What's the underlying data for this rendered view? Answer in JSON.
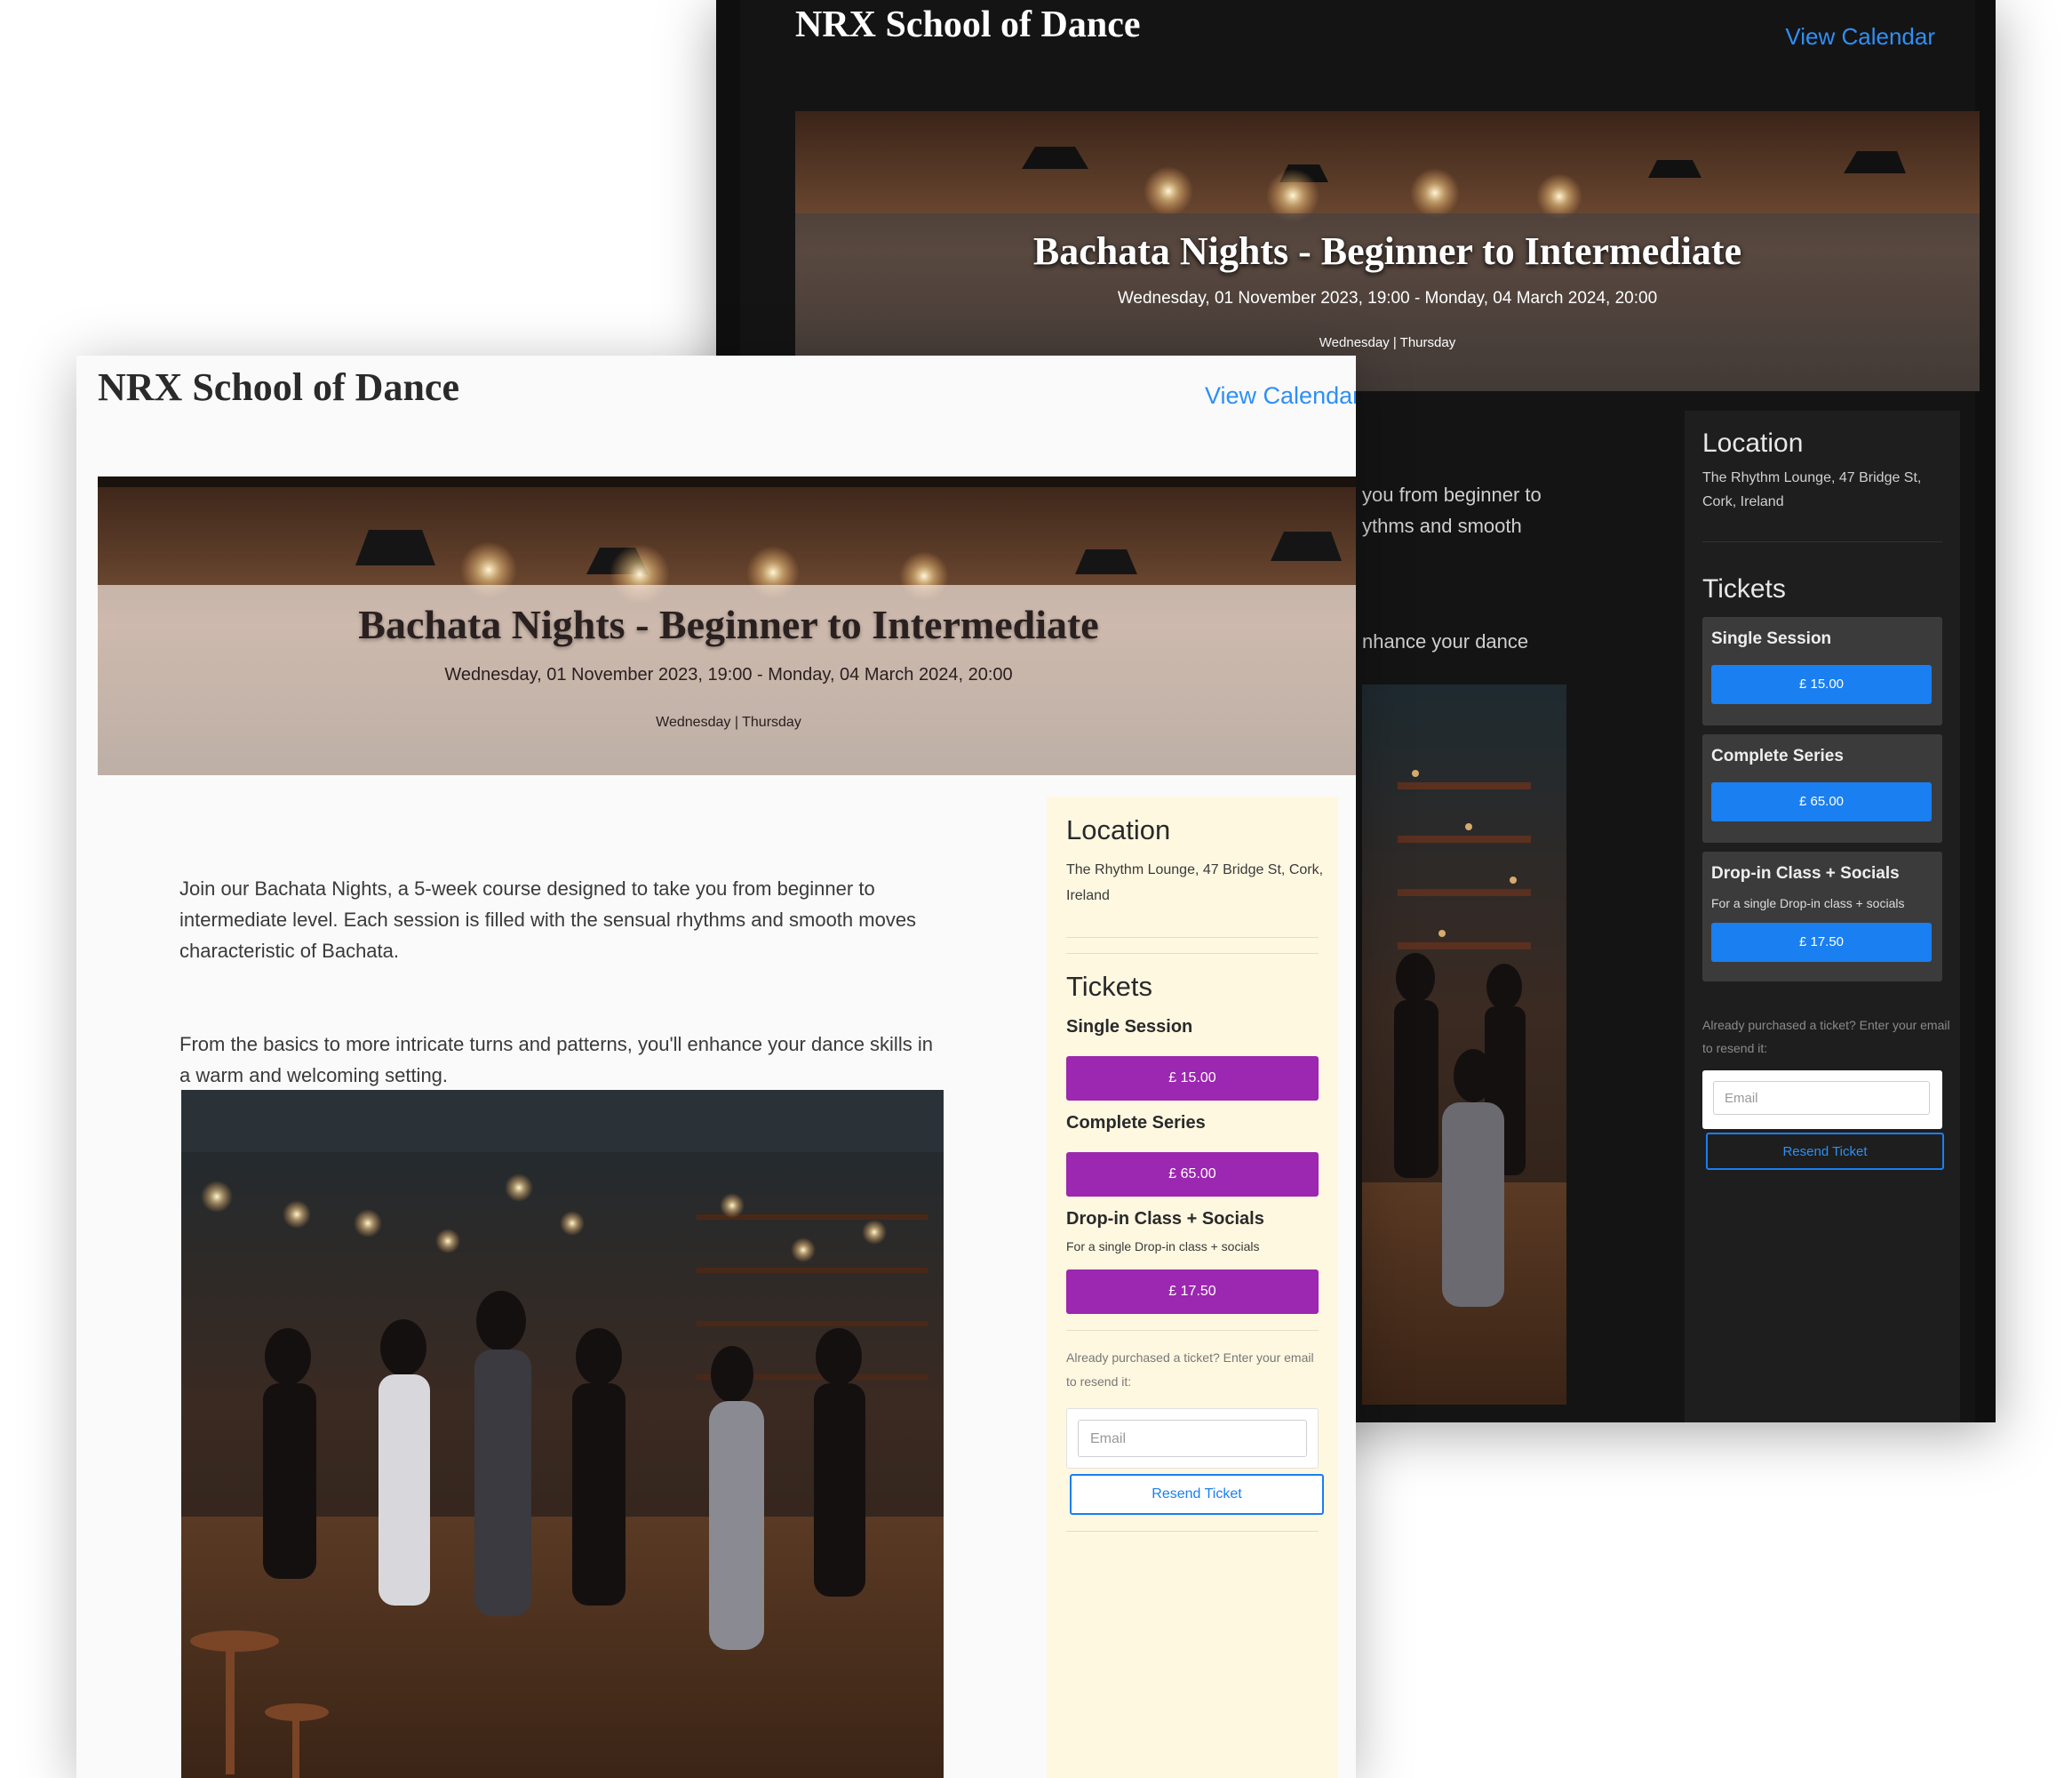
{
  "back_screen": {
    "brand": "NRX School of Dance",
    "view_calendar": "View Calendar",
    "event": {
      "title": "Bachata Nights - Beginner to Intermediate",
      "dates": "Wednesday, 01 November 2023, 19:00 - Monday, 04 March 2024, 20:00",
      "days": "Wednesday | Thursday"
    },
    "description_fragments": [
      "you from beginner to",
      "ythms and smooth",
      "nhance your dance"
    ],
    "location": {
      "heading": "Location",
      "address": "The Rhythm Lounge, 47 Bridge St, Cork, Ireland"
    },
    "tickets": {
      "heading": "Tickets",
      "items": [
        {
          "name": "Single Session",
          "note": "",
          "price": "£ 15.00"
        },
        {
          "name": "Complete Series",
          "note": "",
          "price": "£ 65.00"
        },
        {
          "name": "Drop-in Class + Socials",
          "note": "For a single Drop-in class + socials",
          "price": "£ 17.50"
        }
      ]
    },
    "resend": {
      "note": "Already purchased a ticket? Enter your email to resend it:",
      "email_placeholder": "Email",
      "button": "Resend Ticket"
    }
  },
  "front_screen": {
    "brand": "NRX School of Dance",
    "view_calendar": "View Calendar",
    "event": {
      "title": "Bachata Nights - Beginner to Intermediate",
      "dates": "Wednesday, 01 November 2023, 19:00 - Monday, 04 March 2024, 20:00",
      "days": "Wednesday | Thursday"
    },
    "description": [
      "Join our Bachata Nights, a 5-week course designed to take you from beginner to intermediate level. Each session is filled with the sensual rhythms and smooth moves characteristic of Bachata.",
      "From the basics to more intricate turns and patterns, you'll enhance your dance skills in a warm and welcoming setting."
    ],
    "location": {
      "heading": "Location",
      "address": "The Rhythm Lounge, 47 Bridge St, Cork, Ireland"
    },
    "tickets": {
      "heading": "Tickets",
      "items": [
        {
          "name": "Single Session",
          "note": "",
          "price": "£ 15.00"
        },
        {
          "name": "Complete Series",
          "note": "",
          "price": "£ 65.00"
        },
        {
          "name": "Drop-in Class + Socials",
          "note": "For a single Drop-in class + socials",
          "price": "£ 17.50"
        }
      ]
    },
    "resend": {
      "note": "Already purchased a ticket? Enter your email to resend it:",
      "email_placeholder": "Email",
      "button": "Resend Ticket"
    }
  },
  "colors": {
    "accent_blue": "#1a7ff0",
    "ticket_purple": "#9c27b0",
    "sidebar_cream": "#fff8e1"
  }
}
